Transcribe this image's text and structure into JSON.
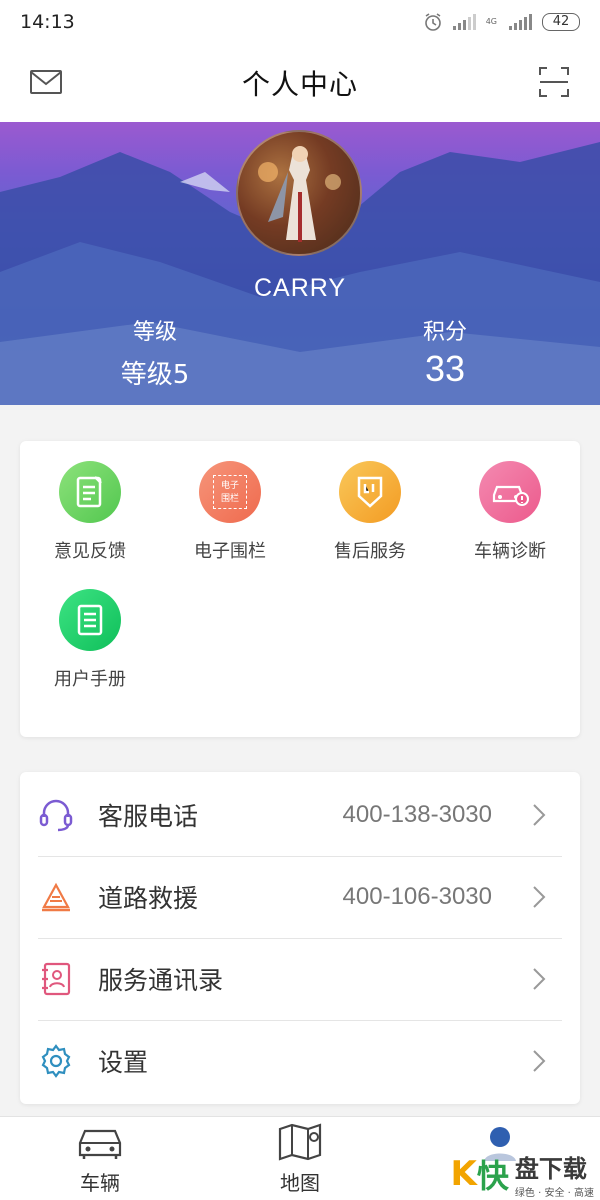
{
  "status_bar": {
    "time": "14:13",
    "network": "4G",
    "battery": "42"
  },
  "header": {
    "title": "个人中心",
    "mail_icon": "mail-icon",
    "scan_icon": "scan-icon"
  },
  "profile": {
    "username": "CARRY",
    "level_label": "等级",
    "level_value": "等级5",
    "points_label": "积分",
    "points_value": "33"
  },
  "features": [
    {
      "label": "意见反馈",
      "icon": "feedback-icon",
      "color": "#6cd66a"
    },
    {
      "label": "电子围栏",
      "icon": "fence-icon",
      "color": "#f27d5e",
      "icon_text_1": "电子",
      "icon_text_2": "围栏"
    },
    {
      "label": "售后服务",
      "icon": "service-icon",
      "color": "#f6b33b"
    },
    {
      "label": "车辆诊断",
      "icon": "car-diagnosis-icon",
      "color": "#f0679a"
    },
    {
      "label": "用户手册",
      "icon": "manual-icon",
      "color": "#1fcf6b"
    }
  ],
  "list": [
    {
      "label": "客服电话",
      "value": "400-138-3030",
      "icon": "headset-icon",
      "color": "#7b5bd2"
    },
    {
      "label": "道路救援",
      "value": "400-106-3030",
      "icon": "road-rescue-icon",
      "color": "#f07a45"
    },
    {
      "label": "服务通讯录",
      "value": "",
      "icon": "contacts-book-icon",
      "color": "#e0577d"
    },
    {
      "label": "设置",
      "value": "",
      "icon": "settings-gear-icon",
      "color": "#2f8fbf"
    }
  ],
  "bottom_nav": [
    {
      "label": "车辆",
      "icon": "car-icon"
    },
    {
      "label": "地图",
      "icon": "map-icon"
    },
    {
      "label": "",
      "icon": "profile-icon"
    }
  ],
  "watermark": {
    "logo_letter": "K",
    "logo_char": "快",
    "main": "盘下载",
    "sub": "绿色 · 安全 · 高速"
  }
}
